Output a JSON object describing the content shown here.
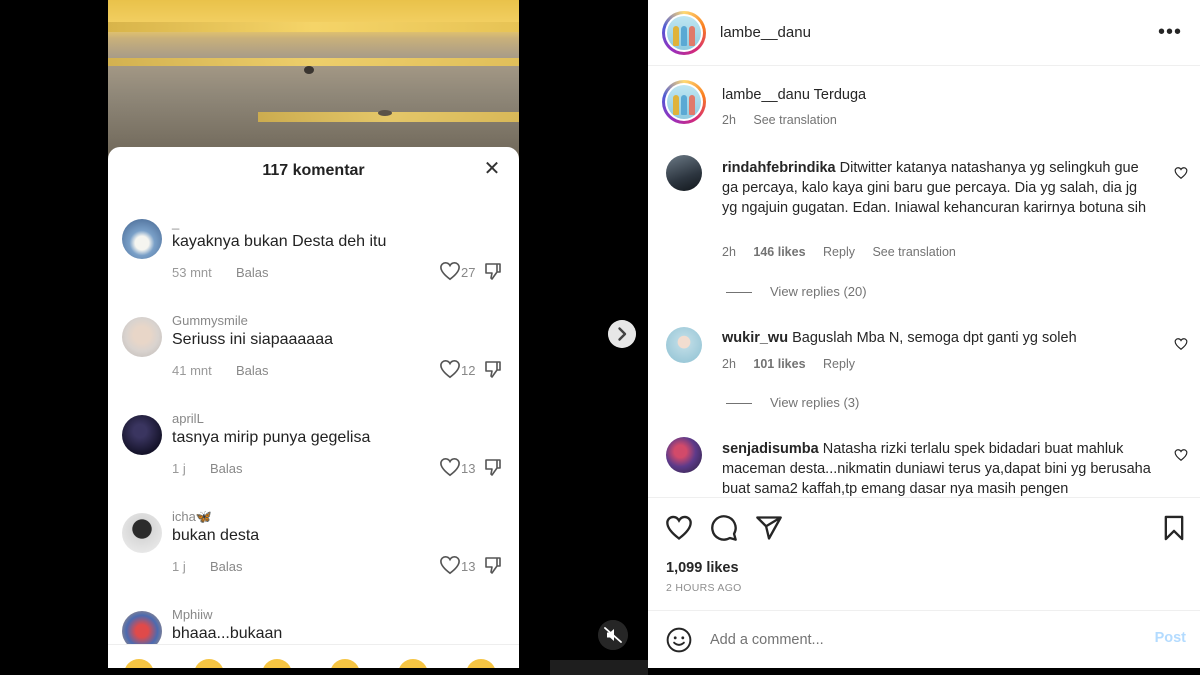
{
  "tiktok": {
    "comment_count_label": "117 komentar",
    "comments": [
      {
        "user": "_",
        "text": "kayaknya bukan Desta deh itu",
        "time": "53 mnt",
        "reply": "Balas",
        "likes": "27"
      },
      {
        "user": "Gummysmile",
        "text": "Seriuss ini siapaaaaaa",
        "time": "41 mnt",
        "reply": "Balas",
        "likes": "12"
      },
      {
        "user": "aprilL",
        "text": "tasnya mirip punya gegelisa",
        "time": "1 j",
        "reply": "Balas",
        "likes": "13"
      },
      {
        "user": "icha🦋",
        "text": "bukan desta",
        "time": "1 j",
        "reply": "Balas",
        "likes": "13"
      },
      {
        "user": "Mphiiw",
        "text": "bhaaa...bukaan"
      }
    ]
  },
  "post": {
    "username": "lambe__danu",
    "caption": {
      "user": "lambe__danu",
      "text": "Terduga",
      "time": "2h",
      "translate": "See translation"
    },
    "comments": [
      {
        "user": "rindahfebrindika",
        "text": "Ditwitter katanya natashanya yg selingkuh gue ga percaya, kalo kaya gini baru gue percaya. Dia yg salah, dia jg yg ngajuin gugatan. Edan. Iniawal kehancuran karirnya botuna sih",
        "time": "2h",
        "likes": "146 likes",
        "reply": "Reply",
        "translate": "See translation",
        "view_replies": "View replies (20)"
      },
      {
        "user": "wukir_wu",
        "text": "Baguslah Mba N, semoga dpt ganti yg soleh",
        "time": "2h",
        "likes": "101 likes",
        "reply": "Reply",
        "view_replies": "View replies (3)"
      },
      {
        "user": "senjadisumba",
        "text": "Natasha rizki terlalu spek bidadari buat mahluk maceman desta...nikmatin duniawi terus ya,dapat bini yg berusaha buat sama2 kaffah,tp emang dasar nya masih pengen"
      }
    ],
    "likes_count": "1,099 likes",
    "time_ago": "2 HOURS AGO",
    "add_comment_placeholder": "Add a comment...",
    "post_button": "Post"
  },
  "colors": {
    "link_blue_disabled": "#b3dbff",
    "text_primary": "#262626",
    "text_secondary": "#737373"
  },
  "icons": [
    "more-icon",
    "heart-icon",
    "comment-icon",
    "share-icon",
    "bookmark-icon",
    "smile-icon",
    "close-icon",
    "dislike-icon",
    "chevron-right-icon",
    "mute-icon"
  ]
}
